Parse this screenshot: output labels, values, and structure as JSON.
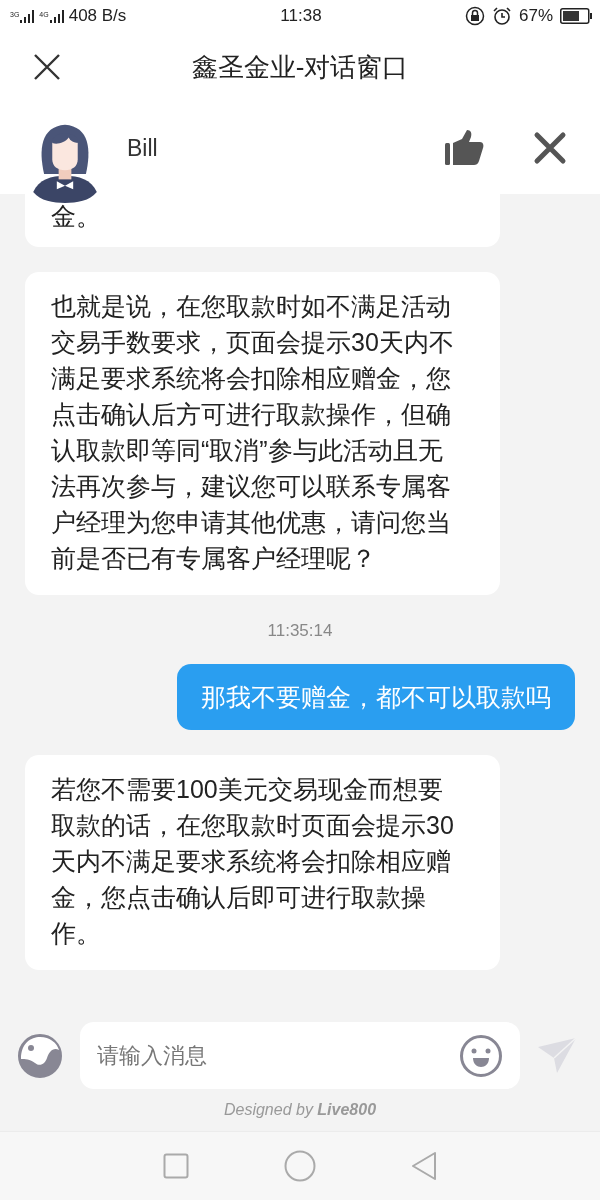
{
  "status_bar": {
    "network_labels": [
      "3G",
      "4G"
    ],
    "network_speed": "408 B/s",
    "time": "11:38",
    "battery": "67%"
  },
  "window": {
    "title": "鑫圣金业-对话窗口"
  },
  "agent": {
    "name": "Bill"
  },
  "messages": [
    {
      "kind": "agent",
      "text": "金。",
      "cut": true
    },
    {
      "kind": "agent",
      "text": "也就是说，在您取款时如不满足活动交易手数要求，页面会提示30天内不满足要求系统将会扣除相应赠金，您点击确认后方可进行取款操作，但确认取款即等同“取消”参与此活动且无法再次参与，建议您可以联系专属客户经理为您申请其他优惠，请问您当前是否已有专属客户经理呢？"
    },
    {
      "kind": "time",
      "text": "11:35:14"
    },
    {
      "kind": "user",
      "text": "那我不要赠金，都不可以取款吗"
    },
    {
      "kind": "agent",
      "text": "若您不需要100美元交易现金而想要取款的话，在您取款时页面会提示30天内不满足要求系统将会扣除相应赠金，您点击确认后即可进行取款操作。"
    }
  ],
  "composer": {
    "placeholder": "请输入消息"
  },
  "footer": {
    "credit": "Designed by **Live800**"
  }
}
